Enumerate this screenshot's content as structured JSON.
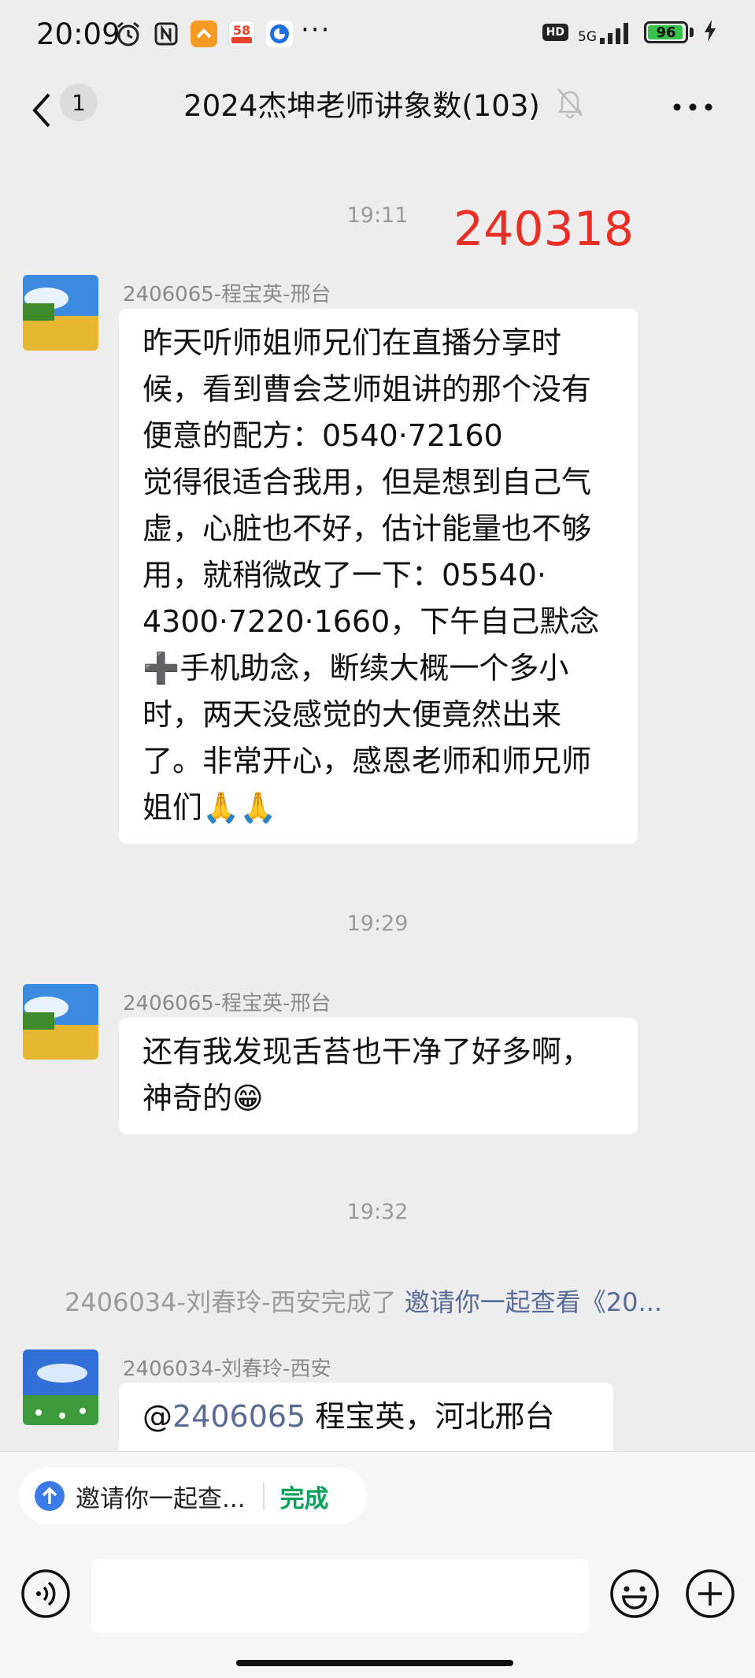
{
  "status_bar": {
    "time": "20:09",
    "network": "5G",
    "hd": "HD",
    "battery": "96",
    "battery_level": 0.96,
    "app58": "58"
  },
  "nav": {
    "unread_count": "1",
    "title": "2024杰坤老师讲象数(103)"
  },
  "chat": {
    "time1": "19:11",
    "red_note": "240318",
    "msg1_sender": "2406065-程宝英-邢台",
    "msg1_text": "昨天听师姐师兄们在直播分享时\n候，看到曹会芝师姐讲的那个没有\n便意的配方：0540·72160\n觉得很适合我用，但是想到自己气\n虚，心脏也不好，估计能量也不够\n用，就稍微改了一下：05540·\n4300·7220·1660，下午自己默念\n➕手机助念，断续大概一个多小\n时，两天没感觉的大便竟然出来\n了。非常开心，感恩老师和师兄师\n姐们🙏🙏",
    "time2": "19:29",
    "msg2_sender": "2406065-程宝英-邢台",
    "msg2_text": "还有我发现舌苔也干净了好多啊，\n神奇的😁",
    "time3": "19:32",
    "system_prefix": "2406034-刘春玲-西安完成了",
    "system_link": "邀请你一起查看《20...",
    "msg3_sender": "2406034-刘春玲-西安",
    "msg3_prefix": "@",
    "msg3_mention": "2406065",
    "msg3_rest": " 程宝英，河北邢台 。"
  },
  "bottom": {
    "todo_text": "邀请你一起查...",
    "todo_done": "完成"
  },
  "colors": {
    "background": "#ededed",
    "red_note": "#e82e25",
    "link": "#576b95",
    "done": "#07a35a",
    "battery": "#39c24b"
  }
}
